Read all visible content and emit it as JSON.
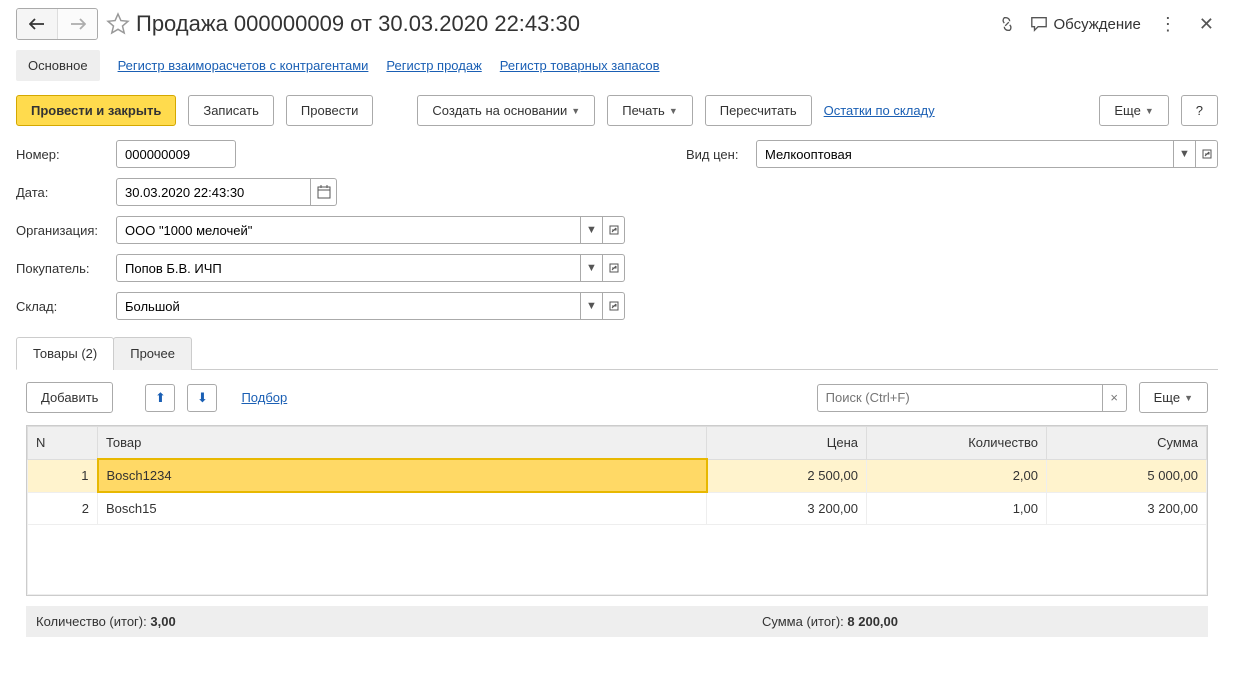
{
  "header": {
    "title": "Продажа 000000009 от 30.03.2020 22:43:30",
    "discuss_label": "Обсуждение"
  },
  "section_tabs": {
    "main": "Основное",
    "reg1": "Регистр взаиморасчетов с контрагентами",
    "reg2": "Регистр продаж",
    "reg3": "Регистр товарных запасов"
  },
  "cmdbar": {
    "post_close": "Провести и закрыть",
    "save": "Записать",
    "post": "Провести",
    "create_on": "Создать на основании",
    "print": "Печать",
    "recalc": "Пересчитать",
    "stock_link": "Остатки по складу",
    "more": "Еще",
    "help": "?"
  },
  "fields": {
    "number_label": "Номер:",
    "number_value": "000000009",
    "date_label": "Дата:",
    "date_value": "30.03.2020 22:43:30",
    "org_label": "Организация:",
    "org_value": "ООО \"1000 мелочей\"",
    "buyer_label": "Покупатель:",
    "buyer_value": "Попов Б.В. ИЧП",
    "warehouse_label": "Склад:",
    "warehouse_value": "Большой",
    "price_type_label": "Вид цен:",
    "price_type_value": "Мелкооптовая"
  },
  "tabs": {
    "goods": "Товары (2)",
    "other": "Прочее"
  },
  "table_cmd": {
    "add": "Добавить",
    "pick": "Подбор",
    "search_placeholder": "Поиск (Ctrl+F)",
    "more": "Еще"
  },
  "columns": {
    "n": "N",
    "product": "Товар",
    "price": "Цена",
    "qty": "Количество",
    "sum": "Сумма"
  },
  "rows": [
    {
      "n": "1",
      "product": "Bosch1234",
      "price": "2 500,00",
      "qty": "2,00",
      "sum": "5 000,00"
    },
    {
      "n": "2",
      "product": "Bosch15",
      "price": "3 200,00",
      "qty": "1,00",
      "sum": "3 200,00"
    }
  ],
  "totals": {
    "qty_label": "Количество (итог):",
    "qty_value": "3,00",
    "sum_label": "Сумма (итог):",
    "sum_value": "8 200,00"
  }
}
